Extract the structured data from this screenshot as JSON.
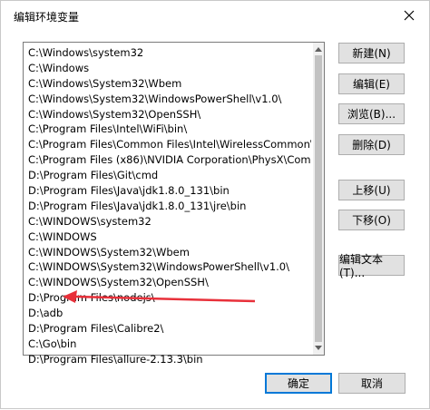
{
  "window": {
    "title": "编辑环境变量",
    "close_icon": "close-icon"
  },
  "path_list": {
    "items": [
      "C:\\Windows\\system32",
      "C:\\Windows",
      "C:\\Windows\\System32\\Wbem",
      "C:\\Windows\\System32\\WindowsPowerShell\\v1.0\\",
      "C:\\Windows\\System32\\OpenSSH\\",
      "C:\\Program Files\\Intel\\WiFi\\bin\\",
      "C:\\Program Files\\Common Files\\Intel\\WirelessCommon\\",
      "C:\\Program Files (x86)\\NVIDIA Corporation\\PhysX\\Common",
      "D:\\Program Files\\Git\\cmd",
      "D:\\Program Files\\Java\\jdk1.8.0_131\\bin",
      "D:\\Program Files\\Java\\jdk1.8.0_131\\jre\\bin",
      "C:\\WINDOWS\\system32",
      "C:\\WINDOWS",
      "C:\\WINDOWS\\System32\\Wbem",
      "C:\\WINDOWS\\System32\\WindowsPowerShell\\v1.0\\",
      "C:\\WINDOWS\\System32\\OpenSSH\\",
      "D:\\Program Files\\nodejs\\",
      "D:\\adb",
      "D:\\Program Files\\Calibre2\\",
      "C:\\Go\\bin",
      "D:\\Program Files\\allure-2.13.3\\bin"
    ]
  },
  "buttons": {
    "new": "新建(N)",
    "edit": "编辑(E)",
    "browse": "浏览(B)...",
    "delete": "删除(D)",
    "move_up": "上移(U)",
    "move_down": "下移(O)",
    "edit_text": "编辑文本(T)...",
    "ok": "确定",
    "cancel": "取消"
  },
  "annotation": {
    "color": "#e8303a",
    "points_to": "D:\\adb"
  }
}
